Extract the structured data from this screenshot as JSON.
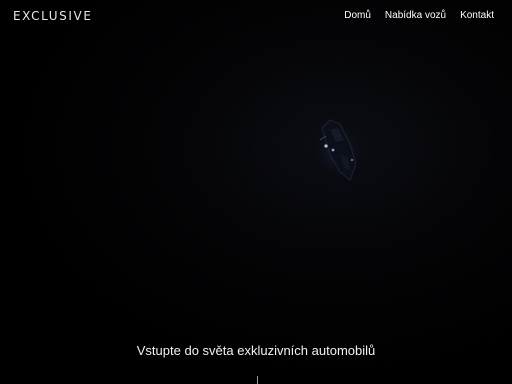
{
  "header": {
    "logo_text": "EXCLUSIVE",
    "nav": {
      "home": "Domů",
      "offer": "Nabídka vozů",
      "contact": "Kontakt"
    }
  },
  "hero": {
    "tagline": "Vstupte do světa exkluzivních automobilů"
  },
  "colors": {
    "background": "#000000",
    "text": "#ffffff"
  }
}
